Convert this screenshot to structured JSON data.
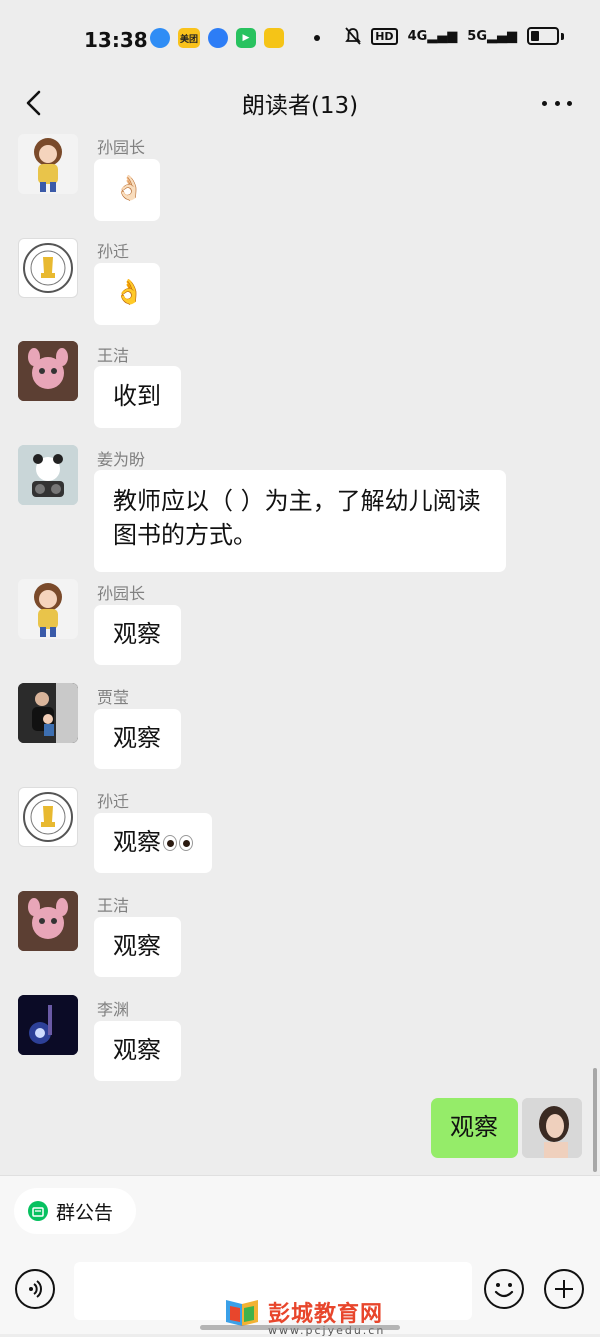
{
  "status_bar": {
    "time": "13:38",
    "apps": [
      {
        "icon": "browser-app-icon",
        "color": "#2f8df5",
        "text": ""
      },
      {
        "icon": "meituan-app-icon",
        "color": "#f9c21b",
        "text": "美团"
      },
      {
        "icon": "blue-app-icon",
        "color": "#2d7df6",
        "text": ""
      },
      {
        "icon": "video-app-icon",
        "color": "#28c25f",
        "text": ""
      },
      {
        "icon": "notes-app-icon",
        "color": "#f5c417",
        "text": ""
      }
    ],
    "right_indicators": [
      "mute-icon",
      "HD",
      "4G",
      "5G"
    ]
  },
  "header": {
    "title": "朗读者(13)"
  },
  "messages": [
    {
      "sender": "孙园长",
      "text": "👌🏻",
      "avatar": "doll-girl-avatar"
    },
    {
      "sender": "孙迁",
      "text": "👌",
      "avatar": "oscar-logo-avatar"
    },
    {
      "sender": "王洁",
      "text": "收到",
      "avatar": "pink-toy-avatar"
    },
    {
      "sender": "姜为盼",
      "text": "教师应以（  ）为主，了解幼儿阅读图书的方式。",
      "avatar": "panda-avatar"
    },
    {
      "sender": "孙园长",
      "text": "观察",
      "avatar": "doll-girl-avatar"
    },
    {
      "sender": "贾莹",
      "text": "观察",
      "avatar": "family-photo-avatar"
    },
    {
      "sender": "孙迁",
      "text": "观察",
      "avatar": "oscar-logo-avatar"
    },
    {
      "sender": "王洁",
      "text": "观察",
      "avatar": "pink-toy-avatar"
    },
    {
      "sender": "李渊",
      "text": "观察",
      "avatar": "night-light-avatar"
    }
  ],
  "my_message": {
    "text": "观察",
    "avatar": "woman-portrait-avatar"
  },
  "footer": {
    "announcement_label": "群公告",
    "input_placeholder": ""
  },
  "watermark": {
    "title": "彭城教育网",
    "url": "www.pcjyedu.cn"
  },
  "colors": {
    "background": "#ededed",
    "my_bubble": "#95ec69",
    "other_bubble": "#ffffff",
    "accent": "#07c160"
  }
}
